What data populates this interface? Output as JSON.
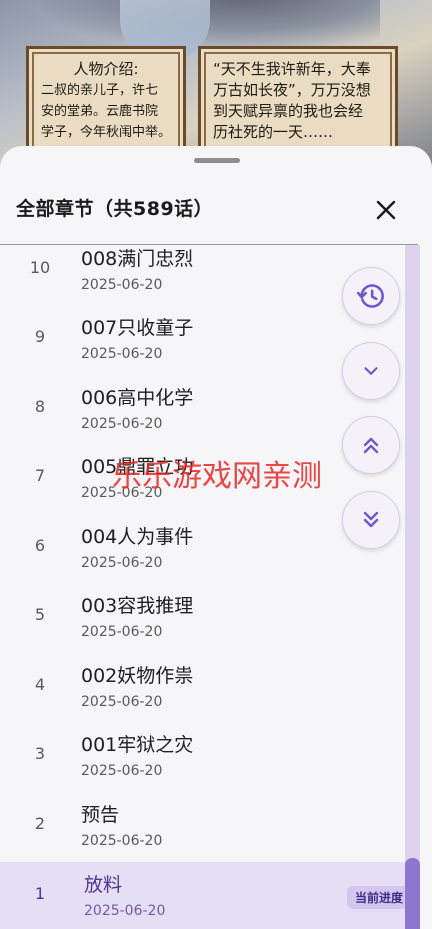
{
  "comic": {
    "left_panel": [
      "人物介绍:",
      "二叔的亲儿子，许七",
      "安的堂弟。云鹿书院",
      "学子，今年秋闱中举。"
    ],
    "right_panel": [
      "“天不生我许新年，大奉",
      "万古如长夜”，万万没想",
      "到天赋异禀的我也会经",
      "历社死的一天……"
    ]
  },
  "sheet": {
    "title": "全部章节（共589话）",
    "close_icon": "close-icon"
  },
  "chapters": [
    {
      "num": "10",
      "title": "008满门忠烈",
      "date": "2025-06-20"
    },
    {
      "num": "9",
      "title": "007只收童子",
      "date": "2025-06-20"
    },
    {
      "num": "8",
      "title": "006高中化学",
      "date": "2025-06-20"
    },
    {
      "num": "7",
      "title": "005鼎罪立功",
      "date": "2025-06-20"
    },
    {
      "num": "6",
      "title": "004人为事件",
      "date": "2025-06-20"
    },
    {
      "num": "5",
      "title": "003容我推理",
      "date": "2025-06-20"
    },
    {
      "num": "4",
      "title": "002妖物作祟",
      "date": "2025-06-20"
    },
    {
      "num": "3",
      "title": "001牢狱之灾",
      "date": "2025-06-20"
    },
    {
      "num": "2",
      "title": "预告",
      "date": "2025-06-20"
    },
    {
      "num": "1",
      "title": "放料",
      "date": "2025-06-20",
      "badge": "当前进度"
    }
  ],
  "fabs": [
    "history-icon",
    "chevron-down-icon",
    "double-chevron-up-icon",
    "double-chevron-down-icon"
  ],
  "watermark": "乐乐游戏网亲测",
  "colors": {
    "accent": "#6f58c9",
    "current_row": "#e6def5",
    "watermark": "#eb2424"
  }
}
